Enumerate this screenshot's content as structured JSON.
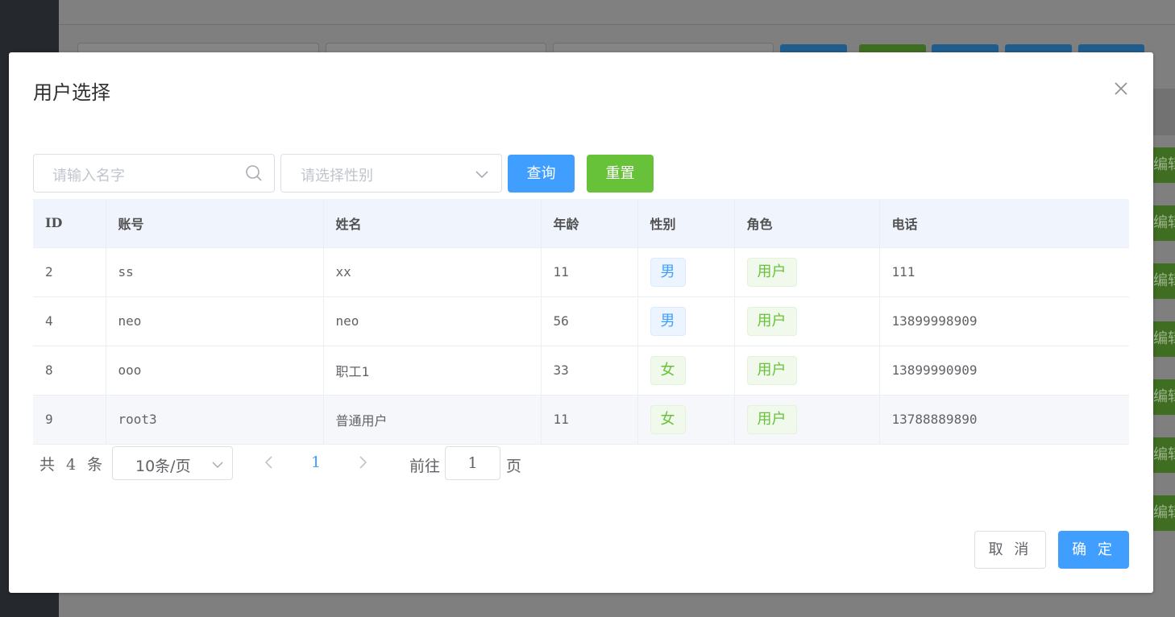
{
  "background": {
    "edit_label": "编辑",
    "colors": {
      "sidebar": "#25282d",
      "blue": "#205c8c",
      "green": "#3f6d21"
    }
  },
  "dialog": {
    "title": "用户选择",
    "close_icon": "close-icon"
  },
  "filters": {
    "name_placeholder": "请输入名字",
    "gender_placeholder": "请选择性别",
    "query_label": "查询",
    "reset_label": "重置"
  },
  "table": {
    "columns": [
      "ID",
      "账号",
      "姓名",
      "年龄",
      "性别",
      "角色",
      "电话"
    ],
    "rows": [
      {
        "id": "2",
        "account": "ss",
        "name": "xx",
        "age": "11",
        "gender": "男",
        "role": "用户",
        "phone": "111"
      },
      {
        "id": "4",
        "account": "neo",
        "name": "neo",
        "age": "56",
        "gender": "男",
        "role": "用户",
        "phone": "13899998909"
      },
      {
        "id": "8",
        "account": "ooo",
        "name": "职工1",
        "age": "33",
        "gender": "女",
        "role": "用户",
        "phone": "13899990909"
      },
      {
        "id": "9",
        "account": "root3",
        "name": "普通用户",
        "age": "11",
        "gender": "女",
        "role": "用户",
        "phone": "13788889890"
      }
    ]
  },
  "pagination": {
    "total": "共 4 条",
    "page_size": "10条/页",
    "current_page": "1",
    "goto_label": "前往",
    "goto_value": "1",
    "unit_label": "页"
  },
  "footer": {
    "cancel_label": "取 消",
    "confirm_label": "确 定"
  },
  "colors": {
    "primary": "#409eff",
    "success": "#67c23a"
  }
}
